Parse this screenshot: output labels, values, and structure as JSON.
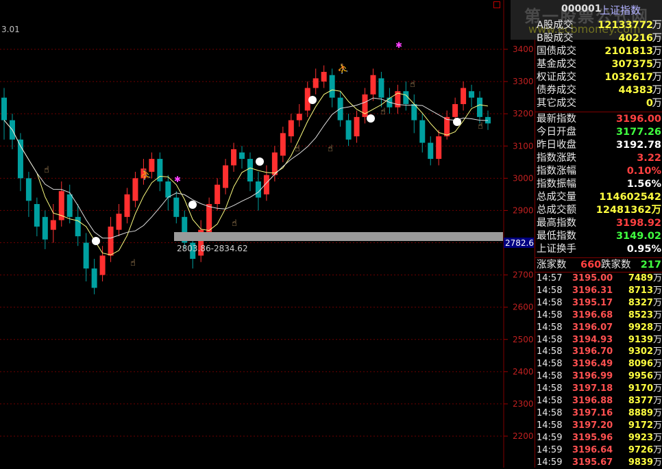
{
  "header": {
    "code": "000001",
    "name": "上证指数",
    "watermark": "第一股票公式网",
    "watermark_sub": "www.ecbmoney.com"
  },
  "chart": {
    "corner_value": "3.01",
    "range_label": "2803.86-2834.62",
    "current_price_tag": "2782.6",
    "y_ticks": [
      "3400",
      "3300",
      "3200",
      "3100",
      "3000",
      "2900",
      "2800",
      "2700",
      "2600",
      "2500",
      "2400",
      "2300",
      "2200"
    ],
    "colors": {
      "up": "#ff3030",
      "down": "#00a0a0",
      "ma1": "#ffff80",
      "ma2": "#e0e0e0"
    }
  },
  "chart_data": {
    "type": "candlestick",
    "ylim": [
      2150,
      3460
    ],
    "y_ticks": [
      3400,
      3300,
      3200,
      3100,
      3000,
      2900,
      2800,
      2700,
      2600,
      2500,
      2400,
      2300,
      2200
    ],
    "candles": [
      [
        3250,
        3180,
        3280,
        3120
      ],
      [
        3180,
        3120,
        3200,
        3090
      ],
      [
        3120,
        3000,
        3140,
        2960
      ],
      [
        3000,
        2930,
        3020,
        2880
      ],
      [
        2920,
        2850,
        2940,
        2820
      ],
      [
        2880,
        2810,
        2900,
        2780
      ],
      [
        2840,
        2870,
        2920,
        2800
      ],
      [
        2870,
        2960,
        2990,
        2850
      ],
      [
        2950,
        2880,
        2980,
        2860
      ],
      [
        2880,
        2820,
        2920,
        2790
      ],
      [
        2800,
        2720,
        2830,
        2680
      ],
      [
        2720,
        2660,
        2750,
        2640
      ],
      [
        2700,
        2760,
        2790,
        2680
      ],
      [
        2760,
        2850,
        2880,
        2740
      ],
      [
        2840,
        2890,
        2920,
        2820
      ],
      [
        2880,
        2950,
        2970,
        2860
      ],
      [
        2930,
        3000,
        3020,
        2910
      ],
      [
        3000,
        3030,
        3060,
        2980
      ],
      [
        3020,
        3060,
        3080,
        3000
      ],
      [
        3060,
        2990,
        3080,
        2960
      ],
      [
        2990,
        2940,
        3010,
        2900
      ],
      [
        2940,
        2880,
        2960,
        2860
      ],
      [
        2880,
        2800,
        2900,
        2780
      ],
      [
        2800,
        2750,
        2830,
        2720
      ],
      [
        2760,
        2840,
        2870,
        2740
      ],
      [
        2830,
        2920,
        2940,
        2820
      ],
      [
        2920,
        2980,
        3000,
        2900
      ],
      [
        2970,
        3040,
        3060,
        2950
      ],
      [
        3040,
        3090,
        3110,
        3020
      ],
      [
        3080,
        3060,
        3100,
        3030
      ],
      [
        3060,
        2990,
        3080,
        2960
      ],
      [
        2990,
        2940,
        3020,
        2900
      ],
      [
        2950,
        3010,
        3040,
        2930
      ],
      [
        3010,
        3080,
        3100,
        2990
      ],
      [
        3070,
        3140,
        3160,
        3050
      ],
      [
        3130,
        3180,
        3200,
        3110
      ],
      [
        3180,
        3200,
        3230,
        3160
      ],
      [
        3210,
        3280,
        3300,
        3190
      ],
      [
        3280,
        3310,
        3340,
        3260
      ],
      [
        3300,
        3330,
        3350,
        3280
      ],
      [
        3320,
        3250,
        3340,
        3220
      ],
      [
        3250,
        3180,
        3270,
        3160
      ],
      [
        3180,
        3120,
        3200,
        3100
      ],
      [
        3130,
        3190,
        3210,
        3110
      ],
      [
        3190,
        3260,
        3280,
        3170
      ],
      [
        3260,
        3320,
        3340,
        3240
      ],
      [
        3310,
        3250,
        3330,
        3220
      ],
      [
        3250,
        3220,
        3280,
        3200
      ],
      [
        3220,
        3270,
        3290,
        3200
      ],
      [
        3270,
        3230,
        3300,
        3210
      ],
      [
        3230,
        3180,
        3260,
        3140
      ],
      [
        3180,
        3110,
        3200,
        3080
      ],
      [
        3110,
        3060,
        3130,
        3040
      ],
      [
        3060,
        3130,
        3150,
        3040
      ],
      [
        3130,
        3190,
        3210,
        3120
      ],
      [
        3190,
        3230,
        3250,
        3170
      ],
      [
        3230,
        3280,
        3300,
        3210
      ],
      [
        3270,
        3250,
        3290,
        3220
      ],
      [
        3250,
        3190,
        3270,
        3170
      ],
      [
        3190,
        3170,
        3210,
        3150
      ]
    ]
  },
  "panel": {
    "volumes": [
      {
        "label": "A股成交",
        "value": "12133772",
        "unit": "万"
      },
      {
        "label": "B股成交",
        "value": "40216",
        "unit": "万"
      },
      {
        "label": "国债成交",
        "value": "2101813",
        "unit": "万"
      },
      {
        "label": "基金成交",
        "value": "307375",
        "unit": "万"
      },
      {
        "label": "权证成交",
        "value": "1032617",
        "unit": "万"
      },
      {
        "label": "债券成交",
        "value": "44383",
        "unit": "万"
      },
      {
        "label": "其它成交",
        "value": "0",
        "unit": "万"
      }
    ],
    "index": [
      {
        "label": "最新指数",
        "value": "3196.00",
        "color": "#ff4040"
      },
      {
        "label": "今日开盘",
        "value": "3177.26",
        "color": "#40ff40"
      },
      {
        "label": "昨日收盘",
        "value": "3192.78",
        "color": "#ffffff"
      },
      {
        "label": "指数涨跌",
        "value": "3.22",
        "color": "#ff4040"
      },
      {
        "label": "指数涨幅",
        "value": "0.10%",
        "color": "#ff4040"
      },
      {
        "label": "指数振幅",
        "value": "1.56%",
        "color": "#ffffff"
      },
      {
        "label": "总成交量",
        "value": "114602542",
        "color": "#ffff40"
      },
      {
        "label": "总成交额",
        "value": "12481362万",
        "color": "#ffff40"
      },
      {
        "label": "最高指数",
        "value": "3198.92",
        "color": "#ff4040"
      },
      {
        "label": "最低指数",
        "value": "3149.02",
        "color": "#40ff40"
      },
      {
        "label": "上证换手",
        "value": "0.95%",
        "color": "#ffffff"
      }
    ],
    "breadth": {
      "up_label": "涨家数",
      "up_value": "660",
      "down_label": "跌家数",
      "down_value": "217"
    },
    "ticks": [
      {
        "time": "14:57",
        "price": "3195.00",
        "vol": "7489",
        "unit": "万"
      },
      {
        "time": "14:58",
        "price": "3196.31",
        "vol": "8713",
        "unit": "万"
      },
      {
        "time": "14:58",
        "price": "3195.17",
        "vol": "8327",
        "unit": "万"
      },
      {
        "time": "14:58",
        "price": "3196.68",
        "vol": "8523",
        "unit": "万"
      },
      {
        "time": "14:58",
        "price": "3196.07",
        "vol": "9928",
        "unit": "万"
      },
      {
        "time": "14:58",
        "price": "3194.93",
        "vol": "9139",
        "unit": "万"
      },
      {
        "time": "14:58",
        "price": "3196.70",
        "vol": "9302",
        "unit": "万"
      },
      {
        "time": "14:58",
        "price": "3196.49",
        "vol": "8096",
        "unit": "万"
      },
      {
        "time": "14:58",
        "price": "3196.99",
        "vol": "9956",
        "unit": "万"
      },
      {
        "time": "14:58",
        "price": "3197.18",
        "vol": "9170",
        "unit": "万"
      },
      {
        "time": "14:58",
        "price": "3196.88",
        "vol": "8377",
        "unit": "万"
      },
      {
        "time": "14:58",
        "price": "3197.16",
        "vol": "8889",
        "unit": "万"
      },
      {
        "time": "14:58",
        "price": "3197.20",
        "vol": "9172",
        "unit": "万"
      },
      {
        "time": "14:59",
        "price": "3195.96",
        "vol": "9923",
        "unit": "万"
      },
      {
        "time": "14:59",
        "price": "3196.64",
        "vol": "9726",
        "unit": "万"
      },
      {
        "time": "14:59",
        "price": "3195.67",
        "vol": "9839",
        "unit": "万"
      }
    ]
  }
}
